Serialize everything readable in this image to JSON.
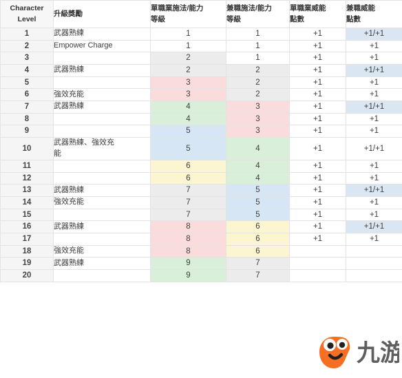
{
  "table": {
    "headers": [
      {
        "id": "character-level",
        "lines": [
          "Character",
          "Level"
        ]
      },
      {
        "id": "level-reward",
        "lines": [
          "升級獎勵"
        ]
      },
      {
        "id": "single-class-casting-level",
        "lines": [
          "單職業施法/能力",
          "等級"
        ]
      },
      {
        "id": "multiclass-casting-level",
        "lines": [
          "兼職施法/能力",
          "等級"
        ]
      },
      {
        "id": "single-class-power-points",
        "lines": [
          "單職業威能",
          "點數"
        ]
      },
      {
        "id": "multiclass-power-points",
        "lines": [
          "兼職威能",
          "點數"
        ]
      }
    ],
    "rows": [
      {
        "level": "1",
        "reward": [
          "武器熟練"
        ],
        "single_lvl": "1",
        "single_lvl_bg": "white",
        "multi_lvl": "1",
        "multi_lvl_bg": "white",
        "single_pp": "+1",
        "single_pp_bg": "white",
        "multi_pp": "+1/+1",
        "multi_pp_bg": "bluelt"
      },
      {
        "level": "2",
        "reward": [
          "Empower Charge"
        ],
        "single_lvl": "1",
        "single_lvl_bg": "white",
        "multi_lvl": "1",
        "multi_lvl_bg": "white",
        "single_pp": "+1",
        "single_pp_bg": "white",
        "multi_pp": "+1",
        "multi_pp_bg": "white"
      },
      {
        "level": "3",
        "reward": [],
        "single_lvl": "2",
        "single_lvl_bg": "grey",
        "multi_lvl": "1",
        "multi_lvl_bg": "white",
        "single_pp": "+1",
        "single_pp_bg": "white",
        "multi_pp": "+1",
        "multi_pp_bg": "white"
      },
      {
        "level": "4",
        "reward": [
          "武器熟練"
        ],
        "single_lvl": "2",
        "single_lvl_bg": "grey",
        "multi_lvl": "2",
        "multi_lvl_bg": "grey",
        "single_pp": "+1",
        "single_pp_bg": "white",
        "multi_pp": "+1/+1",
        "multi_pp_bg": "bluelt"
      },
      {
        "level": "5",
        "reward": [],
        "single_lvl": "3",
        "single_lvl_bg": "pink",
        "multi_lvl": "2",
        "multi_lvl_bg": "grey",
        "single_pp": "+1",
        "single_pp_bg": "white",
        "multi_pp": "+1",
        "multi_pp_bg": "white"
      },
      {
        "level": "6",
        "reward": [
          "強效充能"
        ],
        "single_lvl": "3",
        "single_lvl_bg": "pink",
        "multi_lvl": "2",
        "multi_lvl_bg": "grey",
        "single_pp": "+1",
        "single_pp_bg": "white",
        "multi_pp": "+1",
        "multi_pp_bg": "white"
      },
      {
        "level": "7",
        "reward": [
          "武器熟練"
        ],
        "single_lvl": "4",
        "single_lvl_bg": "green",
        "multi_lvl": "3",
        "multi_lvl_bg": "pink",
        "single_pp": "+1",
        "single_pp_bg": "white",
        "multi_pp": "+1/+1",
        "multi_pp_bg": "bluelt"
      },
      {
        "level": "8",
        "reward": [],
        "single_lvl": "4",
        "single_lvl_bg": "green",
        "multi_lvl": "3",
        "multi_lvl_bg": "pink",
        "single_pp": "+1",
        "single_pp_bg": "white",
        "multi_pp": "+1",
        "multi_pp_bg": "white"
      },
      {
        "level": "9",
        "reward": [],
        "single_lvl": "5",
        "single_lvl_bg": "blue",
        "multi_lvl": "3",
        "multi_lvl_bg": "pink",
        "single_pp": "+1",
        "single_pp_bg": "white",
        "multi_pp": "+1",
        "multi_pp_bg": "white"
      },
      {
        "level": "10",
        "reward": [
          "武器熟練、強效充",
          "能"
        ],
        "single_lvl": "5",
        "single_lvl_bg": "blue",
        "multi_lvl": "4",
        "multi_lvl_bg": "green",
        "single_pp": "+1",
        "single_pp_bg": "white",
        "multi_pp": "+1/+1",
        "multi_pp_bg": "white"
      },
      {
        "level": "11",
        "reward": [],
        "single_lvl": "6",
        "single_lvl_bg": "yellow",
        "multi_lvl": "4",
        "multi_lvl_bg": "green",
        "single_pp": "+1",
        "single_pp_bg": "white",
        "multi_pp": "+1",
        "multi_pp_bg": "white"
      },
      {
        "level": "12",
        "reward": [],
        "single_lvl": "6",
        "single_lvl_bg": "yellow",
        "multi_lvl": "4",
        "multi_lvl_bg": "green",
        "single_pp": "+1",
        "single_pp_bg": "white",
        "multi_pp": "+1",
        "multi_pp_bg": "white"
      },
      {
        "level": "13",
        "reward": [
          "武器熟練"
        ],
        "single_lvl": "7",
        "single_lvl_bg": "grey",
        "multi_lvl": "5",
        "multi_lvl_bg": "blue",
        "single_pp": "+1",
        "single_pp_bg": "white",
        "multi_pp": "+1/+1",
        "multi_pp_bg": "bluelt"
      },
      {
        "level": "14",
        "reward": [
          "強效充能"
        ],
        "single_lvl": "7",
        "single_lvl_bg": "grey",
        "multi_lvl": "5",
        "multi_lvl_bg": "blue",
        "single_pp": "+1",
        "single_pp_bg": "white",
        "multi_pp": "+1",
        "multi_pp_bg": "white"
      },
      {
        "level": "15",
        "reward": [],
        "single_lvl": "7",
        "single_lvl_bg": "grey",
        "multi_lvl": "5",
        "multi_lvl_bg": "blue",
        "single_pp": "+1",
        "single_pp_bg": "white",
        "multi_pp": "+1",
        "multi_pp_bg": "white"
      },
      {
        "level": "16",
        "reward": [
          "武器熟練"
        ],
        "single_lvl": "8",
        "single_lvl_bg": "pink",
        "multi_lvl": "6",
        "multi_lvl_bg": "yellow",
        "single_pp": "+1",
        "single_pp_bg": "white",
        "multi_pp": "+1/+1",
        "multi_pp_bg": "bluelt"
      },
      {
        "level": "17",
        "reward": [],
        "single_lvl": "8",
        "single_lvl_bg": "pink",
        "multi_lvl": "6",
        "multi_lvl_bg": "yellow",
        "single_pp": "+1",
        "single_pp_bg": "white",
        "multi_pp": "+1",
        "multi_pp_bg": "white"
      },
      {
        "level": "18",
        "reward": [
          "強效充能"
        ],
        "single_lvl": "8",
        "single_lvl_bg": "pink",
        "multi_lvl": "6",
        "multi_lvl_bg": "yellow",
        "single_pp": "",
        "single_pp_bg": "white",
        "multi_pp": "",
        "multi_pp_bg": "white"
      },
      {
        "level": "19",
        "reward": [
          "武器熟練"
        ],
        "single_lvl": "9",
        "single_lvl_bg": "green",
        "multi_lvl": "7",
        "multi_lvl_bg": "grey",
        "single_pp": "",
        "single_pp_bg": "white",
        "multi_pp": "",
        "multi_pp_bg": "white"
      },
      {
        "level": "20",
        "reward": [],
        "single_lvl": "9",
        "single_lvl_bg": "green",
        "multi_lvl": "7",
        "multi_lvl_bg": "grey",
        "single_pp": "",
        "single_pp_bg": "white",
        "multi_pp": "",
        "multi_pp_bg": "white"
      }
    ]
  },
  "watermark": {
    "text": "九游",
    "mascot_color": "#F76B1C",
    "text_color": "#5a5a5a"
  }
}
